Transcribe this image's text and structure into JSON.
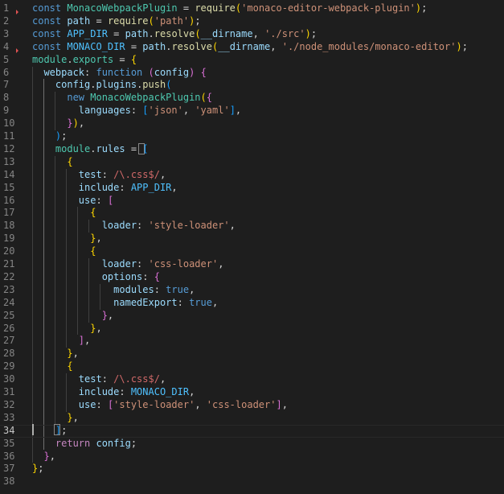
{
  "colors": {
    "keyword": "#569cd6",
    "identifier": "#9cdcfe",
    "type": "#4ec9b0",
    "function": "#dcdcaa",
    "string": "#ce9178",
    "regex": "#d16969",
    "plain": "#d4d4d4",
    "bracket1": "#ffd700",
    "bracket2": "#da70d6",
    "bracket3": "#179fff",
    "constant": "#4fc1ff",
    "control": "#c586c0",
    "gutter": "#858585",
    "gutter_active": "#c6c6c6",
    "background": "#1e1e1e"
  },
  "editor": {
    "active_line": 34,
    "lines": [
      {
        "n": "1",
        "tokens": [
          [
            "const ",
            "keyword"
          ],
          [
            "MonacoWebpackPlugin",
            "type"
          ],
          [
            " = ",
            "plain"
          ],
          [
            "require",
            "function"
          ],
          [
            "(",
            "bracket1"
          ],
          [
            "'monaco-editor-webpack-plugin'",
            "string"
          ],
          [
            ")",
            "bracket1"
          ],
          [
            ";",
            "plain"
          ]
        ]
      },
      {
        "n": "2",
        "tokens": [
          [
            "const ",
            "keyword"
          ],
          [
            "path",
            "identifier"
          ],
          [
            " = ",
            "plain"
          ],
          [
            "require",
            "function"
          ],
          [
            "(",
            "bracket1"
          ],
          [
            "'path'",
            "string"
          ],
          [
            ")",
            "bracket1"
          ],
          [
            ";",
            "plain"
          ]
        ]
      },
      {
        "n": "3",
        "tokens": [
          [
            "const ",
            "keyword"
          ],
          [
            "APP_DIR",
            "constant"
          ],
          [
            " = ",
            "plain"
          ],
          [
            "path",
            "identifier"
          ],
          [
            ".",
            "plain"
          ],
          [
            "resolve",
            "function"
          ],
          [
            "(",
            "bracket1"
          ],
          [
            "__dirname",
            "identifier"
          ],
          [
            ", ",
            "plain"
          ],
          [
            "'./src'",
            "string"
          ],
          [
            ")",
            "bracket1"
          ],
          [
            ";",
            "plain"
          ]
        ]
      },
      {
        "n": "4",
        "tokens": [
          [
            "const ",
            "keyword"
          ],
          [
            "MONACO_DIR",
            "constant"
          ],
          [
            " = ",
            "plain"
          ],
          [
            "path",
            "identifier"
          ],
          [
            ".",
            "plain"
          ],
          [
            "resolve",
            "function"
          ],
          [
            "(",
            "bracket1"
          ],
          [
            "__dirname",
            "identifier"
          ],
          [
            ", ",
            "plain"
          ],
          [
            "'./node_modules/monaco-editor'",
            "string"
          ],
          [
            ")",
            "bracket1"
          ],
          [
            ";",
            "plain"
          ]
        ]
      },
      {
        "n": "5",
        "tokens": [
          [
            "module",
            "type"
          ],
          [
            ".",
            "plain"
          ],
          [
            "exports",
            "type"
          ],
          [
            " = ",
            "plain"
          ],
          [
            "{",
            "bracket1"
          ]
        ]
      },
      {
        "n": "6",
        "tokens": [
          [
            "  webpack",
            "identifier"
          ],
          [
            ": ",
            "plain"
          ],
          [
            "function ",
            "keyword"
          ],
          [
            "(",
            "bracket2"
          ],
          [
            "config",
            "identifier"
          ],
          [
            ") ",
            "bracket2"
          ],
          [
            "{",
            "bracket2"
          ]
        ]
      },
      {
        "n": "7",
        "tokens": [
          [
            "    config",
            "identifier"
          ],
          [
            ".",
            "plain"
          ],
          [
            "plugins",
            "identifier"
          ],
          [
            ".",
            "plain"
          ],
          [
            "push",
            "function"
          ],
          [
            "(",
            "bracket3"
          ]
        ]
      },
      {
        "n": "8",
        "tokens": [
          [
            "      new ",
            "keyword"
          ],
          [
            "MonacoWebpackPlugin",
            "type"
          ],
          [
            "(",
            "bracket1"
          ],
          [
            "{",
            "bracket2"
          ]
        ]
      },
      {
        "n": "9",
        "tokens": [
          [
            "        languages",
            "identifier"
          ],
          [
            ": ",
            "plain"
          ],
          [
            "[",
            "bracket3"
          ],
          [
            "'json'",
            "string"
          ],
          [
            ", ",
            "plain"
          ],
          [
            "'yaml'",
            "string"
          ],
          [
            "]",
            "bracket3"
          ],
          [
            ",",
            "plain"
          ]
        ]
      },
      {
        "n": "10",
        "tokens": [
          [
            "      }",
            "bracket2"
          ],
          [
            ")",
            "bracket1"
          ],
          [
            ",",
            "plain"
          ]
        ]
      },
      {
        "n": "11",
        "tokens": [
          [
            "    )",
            "bracket3"
          ],
          [
            ";",
            "plain"
          ]
        ]
      },
      {
        "n": "12",
        "tokens": [
          [
            "    module",
            "type"
          ],
          [
            ".",
            "plain"
          ],
          [
            "rules",
            "identifier"
          ],
          [
            " = ",
            "plain"
          ],
          [
            "[",
            "bracket3"
          ]
        ]
      },
      {
        "n": "13",
        "tokens": [
          [
            "      {",
            "bracket1"
          ]
        ]
      },
      {
        "n": "14",
        "tokens": [
          [
            "        test",
            "identifier"
          ],
          [
            ": ",
            "plain"
          ],
          [
            "/\\.css$/",
            "regex"
          ],
          [
            ",",
            "plain"
          ]
        ]
      },
      {
        "n": "15",
        "tokens": [
          [
            "        include",
            "identifier"
          ],
          [
            ": ",
            "plain"
          ],
          [
            "APP_DIR",
            "constant"
          ],
          [
            ",",
            "plain"
          ]
        ]
      },
      {
        "n": "16",
        "tokens": [
          [
            "        use",
            "identifier"
          ],
          [
            ": ",
            "plain"
          ],
          [
            "[",
            "bracket2"
          ]
        ]
      },
      {
        "n": "17",
        "tokens": [
          [
            "          {",
            "bracket1"
          ]
        ]
      },
      {
        "n": "18",
        "tokens": [
          [
            "            loader",
            "identifier"
          ],
          [
            ": ",
            "plain"
          ],
          [
            "'style-loader'",
            "string"
          ],
          [
            ",",
            "plain"
          ]
        ]
      },
      {
        "n": "19",
        "tokens": [
          [
            "          }",
            "bracket1"
          ],
          [
            ",",
            "plain"
          ]
        ]
      },
      {
        "n": "20",
        "tokens": [
          [
            "          {",
            "bracket1"
          ]
        ]
      },
      {
        "n": "21",
        "tokens": [
          [
            "            loader",
            "identifier"
          ],
          [
            ": ",
            "plain"
          ],
          [
            "'css-loader'",
            "string"
          ],
          [
            ",",
            "plain"
          ]
        ]
      },
      {
        "n": "22",
        "tokens": [
          [
            "            options",
            "identifier"
          ],
          [
            ": ",
            "plain"
          ],
          [
            "{",
            "bracket2"
          ]
        ]
      },
      {
        "n": "23",
        "tokens": [
          [
            "              modules",
            "identifier"
          ],
          [
            ": ",
            "plain"
          ],
          [
            "true",
            "keyword"
          ],
          [
            ",",
            "plain"
          ]
        ]
      },
      {
        "n": "24",
        "tokens": [
          [
            "              namedExport",
            "identifier"
          ],
          [
            ": ",
            "plain"
          ],
          [
            "true",
            "keyword"
          ],
          [
            ",",
            "plain"
          ]
        ]
      },
      {
        "n": "25",
        "tokens": [
          [
            "            }",
            "bracket2"
          ],
          [
            ",",
            "plain"
          ]
        ]
      },
      {
        "n": "26",
        "tokens": [
          [
            "          }",
            "bracket1"
          ],
          [
            ",",
            "plain"
          ]
        ]
      },
      {
        "n": "27",
        "tokens": [
          [
            "        ]",
            "bracket2"
          ],
          [
            ",",
            "plain"
          ]
        ]
      },
      {
        "n": "28",
        "tokens": [
          [
            "      }",
            "bracket1"
          ],
          [
            ",",
            "plain"
          ]
        ]
      },
      {
        "n": "29",
        "tokens": [
          [
            "      {",
            "bracket1"
          ]
        ]
      },
      {
        "n": "30",
        "tokens": [
          [
            "        test",
            "identifier"
          ],
          [
            ": ",
            "plain"
          ],
          [
            "/\\.css$/",
            "regex"
          ],
          [
            ",",
            "plain"
          ]
        ]
      },
      {
        "n": "31",
        "tokens": [
          [
            "        include",
            "identifier"
          ],
          [
            ": ",
            "plain"
          ],
          [
            "MONACO_DIR",
            "constant"
          ],
          [
            ",",
            "plain"
          ]
        ]
      },
      {
        "n": "32",
        "tokens": [
          [
            "        use",
            "identifier"
          ],
          [
            ": ",
            "plain"
          ],
          [
            "[",
            "bracket2"
          ],
          [
            "'style-loader'",
            "string"
          ],
          [
            ", ",
            "plain"
          ],
          [
            "'css-loader'",
            "string"
          ],
          [
            "]",
            "bracket2"
          ],
          [
            ",",
            "plain"
          ]
        ]
      },
      {
        "n": "33",
        "tokens": [
          [
            "      }",
            "bracket1"
          ],
          [
            ",",
            "plain"
          ]
        ]
      },
      {
        "n": "34",
        "tokens": [
          [
            "    ]",
            "bracket3"
          ],
          [
            ";",
            "plain"
          ]
        ]
      },
      {
        "n": "35",
        "tokens": [
          [
            "    return ",
            "control"
          ],
          [
            "config",
            "identifier"
          ],
          [
            ";",
            "plain"
          ]
        ]
      },
      {
        "n": "36",
        "tokens": [
          [
            "  }",
            "bracket2"
          ],
          [
            ",",
            "plain"
          ]
        ]
      },
      {
        "n": "37",
        "tokens": [
          [
            "}",
            "bracket1"
          ],
          [
            ";",
            "plain"
          ]
        ]
      },
      {
        "n": "38",
        "tokens": []
      }
    ]
  }
}
